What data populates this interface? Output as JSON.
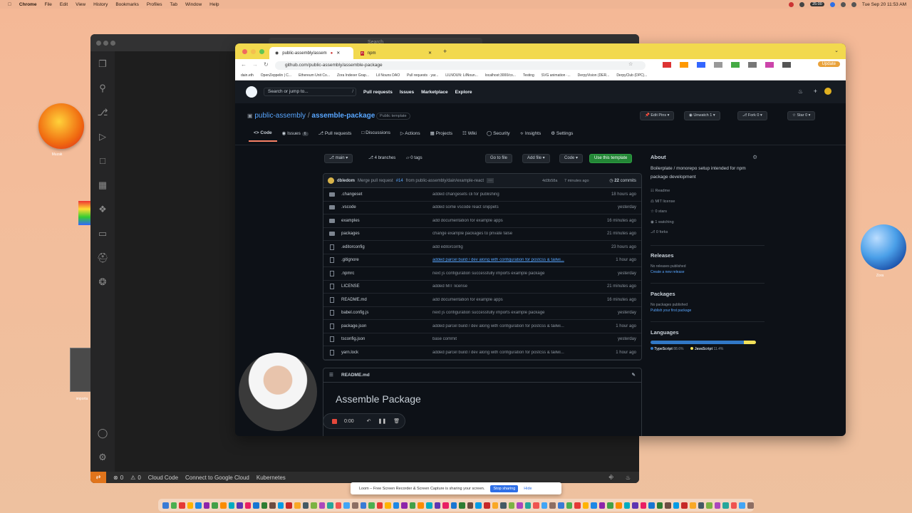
{
  "menubar": {
    "app": "Chrome",
    "items": [
      "File",
      "Edit",
      "View",
      "History",
      "Bookmarks",
      "Profiles",
      "Tab",
      "Window",
      "Help"
    ],
    "clock": "Tue Sep 20  11:53 AM",
    "timer": "25:00"
  },
  "desktop": {
    "icon1_label": "Muzak",
    "icon2_label": "importa",
    "icon3_label": "Zora"
  },
  "vscode": {
    "status": {
      "problems": "0",
      "warnings": "0",
      "cloud_code": "Cloud Code",
      "gcloud": "Connect to Google Cloud",
      "kubernetes": "Kubernetes"
    },
    "search_placeholder": "Search"
  },
  "browser": {
    "tabs": [
      {
        "title": "public-assembly/assem"
      },
      {
        "title": "npm"
      }
    ],
    "url": "github.com/public-assembly/assemble-package",
    "update_label": "Update",
    "bookmarks": [
      "dain.eth",
      "OpenZeppelin | C...",
      "Ethereum Unit Co...",
      "Zora Indexer Grap...",
      "Lil Nouns DAO",
      "Pull requests · yar...",
      "LILNOUN: LilNoun...",
      "localhost:3000/co...",
      "Testing",
      "SVG animation ·...",
      "DerpyVision (DER...",
      "DerpyClub (DPC)..."
    ]
  },
  "github": {
    "search_placeholder": "Search or jump to...",
    "search_key": "/",
    "nav": [
      "Pull requests",
      "Issues",
      "Marketplace",
      "Explore"
    ],
    "owner": "public-assembly",
    "sep": "/",
    "repo": "assemble-package",
    "badge": "Public template",
    "repo_buttons": {
      "edit_pins": "Edit Pins",
      "unwatch": "Unwatch",
      "unwatch_count": "1",
      "fork": "Fork",
      "fork_count": "0",
      "star": "Star",
      "star_count": "0"
    },
    "tabs": [
      {
        "label": "Code"
      },
      {
        "label": "Issues",
        "count": "6"
      },
      {
        "label": "Pull requests"
      },
      {
        "label": "Discussions"
      },
      {
        "label": "Actions"
      },
      {
        "label": "Projects"
      },
      {
        "label": "Wiki"
      },
      {
        "label": "Security"
      },
      {
        "label": "Insights"
      },
      {
        "label": "Settings"
      }
    ],
    "branch": "main",
    "branches": "4 branches",
    "tags": "0 tags",
    "buttons": {
      "go_to_file": "Go to file",
      "add_file": "Add file",
      "code": "Code",
      "use_template": "Use this template"
    },
    "commit": {
      "author": "dbledom",
      "message_prefix": "Merge pull request",
      "pr": "#14",
      "message_suffix": "from public-assembly/dain/example-react",
      "hash": "4d3b58a",
      "time": "7 minutes ago",
      "count": "22",
      "count_label": "commits"
    },
    "files": [
      {
        "name": ".changeset",
        "type": "dir",
        "msg": "added changesets cli for publishing",
        "time": "18 hours ago"
      },
      {
        "name": ".vscode",
        "type": "dir",
        "msg": "added some vscode react snippets",
        "time": "yesterday"
      },
      {
        "name": "examples",
        "type": "dir",
        "msg": "add documentation for example apps",
        "time": "16 minutes ago"
      },
      {
        "name": "packages",
        "type": "dir",
        "msg": "change example packages to private false",
        "time": "21 minutes ago"
      },
      {
        "name": ".editorconfig",
        "type": "file",
        "msg": "add editorconfig",
        "time": "23 hours ago"
      },
      {
        "name": ".gitignore",
        "type": "file",
        "msg": "added parcel build / dev along with configuration for postcss & tailwi...",
        "time": "1 hour ago"
      },
      {
        "name": ".npmrc",
        "type": "file",
        "msg": "next js configuration successfully imports example package",
        "time": "yesterday"
      },
      {
        "name": "LICENSE",
        "type": "file",
        "msg": "added MIT license",
        "time": "21 minutes ago"
      },
      {
        "name": "README.md",
        "type": "file",
        "msg": "add documentation for example apps",
        "time": "16 minutes ago"
      },
      {
        "name": "babel.config.js",
        "type": "file",
        "msg": "next js configuration successfully imports example package",
        "time": "yesterday"
      },
      {
        "name": "package.json",
        "type": "file",
        "msg": "added parcel build / dev along with configuration for postcss & tailwi...",
        "time": "1 hour ago"
      },
      {
        "name": "tsconfig.json",
        "type": "file",
        "msg": "base commit",
        "time": "yesterday"
      },
      {
        "name": "yarn.lock",
        "type": "file",
        "msg": "added parcel build / dev along with configuration for postcss & tailwi...",
        "time": "1 hour ago"
      }
    ],
    "readme": {
      "filename": "README.md",
      "heading": "Assemble Package"
    },
    "about": {
      "title": "About",
      "description": "Boilerplate / monorepo setup intended for npm package development",
      "items": [
        "Readme",
        "MIT license",
        "0 stars",
        "1 watching",
        "0 forks"
      ]
    },
    "releases": {
      "title": "Releases",
      "none": "No releases published",
      "link": "Create a new release"
    },
    "packages": {
      "title": "Packages",
      "none": "No packages published",
      "link": "Publish your first package"
    },
    "languages": {
      "title": "Languages",
      "items": [
        {
          "name": "TypeScript",
          "pct": "88.6%",
          "color": "#3178c6",
          "value": 88.6
        },
        {
          "name": "JavaScript",
          "pct": "11.4%",
          "color": "#f1e05a",
          "value": 11.4
        }
      ]
    }
  },
  "loom": {
    "timer": "0:00",
    "sharing_text": "Loom – Free Screen Recorder & Screen Capture is sharing your screen.",
    "stop": "Stop sharing",
    "hide": "Hide"
  },
  "colors": {
    "accent_green": "#238636",
    "link_blue": "#58a6ff",
    "tab_underline": "#f78166",
    "chrome_tabstrip": "#f2d94e"
  }
}
